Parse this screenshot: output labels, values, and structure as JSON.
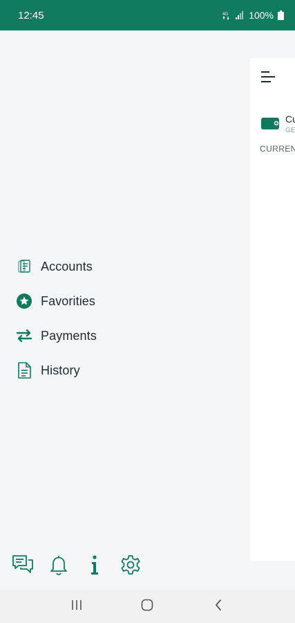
{
  "status_bar": {
    "time": "12:45",
    "battery": "100%",
    "signal_icon": "signal-icon",
    "network_icon": "data-4g-icon",
    "battery_icon": "battery-icon"
  },
  "drawer": {
    "menu": [
      {
        "label": "Accounts",
        "icon": "accounts-icon"
      },
      {
        "label": "Favorities",
        "icon": "star-icon"
      },
      {
        "label": "Payments",
        "icon": "transfer-arrows-icon"
      },
      {
        "label": "History",
        "icon": "document-icon"
      }
    ],
    "bottom_actions": [
      {
        "name": "chat",
        "icon": "chat-icon"
      },
      {
        "name": "notifications",
        "icon": "bell-icon"
      },
      {
        "name": "info",
        "icon": "info-icon"
      },
      {
        "name": "settings",
        "icon": "gear-icon"
      }
    ]
  },
  "main": {
    "account_name": "Cu",
    "account_sub": "GE",
    "section_label": "CURREN"
  },
  "colors": {
    "accent": "#0f7a5e",
    "text": "#1e2b2f",
    "drawer_bg": "#f5f6f8"
  }
}
